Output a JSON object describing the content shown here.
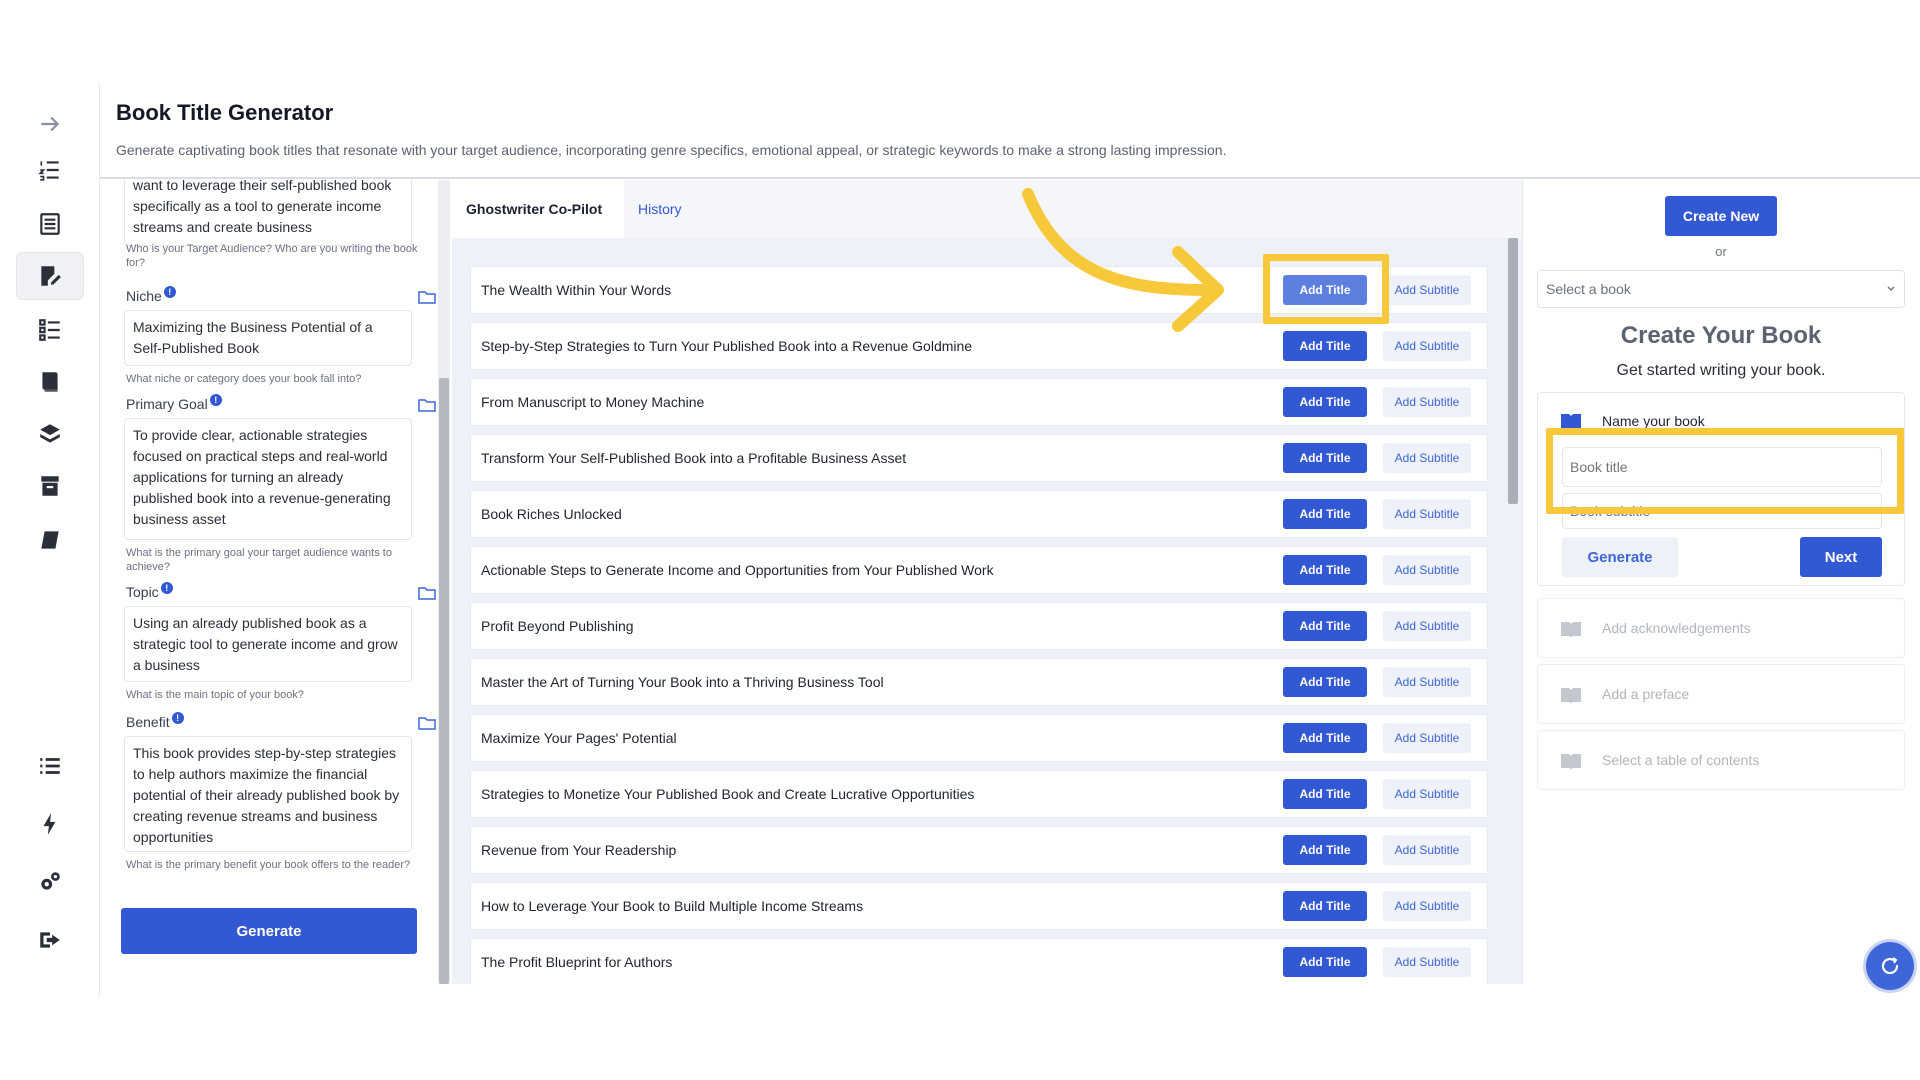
{
  "header": {
    "title": "Book Title Generator",
    "subtitle": "Generate captivating book titles that resonate with your target audience, incorporating genre specifics, emotional appeal, or strategic keywords to make a strong lasting impression."
  },
  "sidebar": {
    "icons": [
      "arrow-right-icon",
      "ordered-list-icon",
      "document-list-icon",
      "edit-document-icon",
      "checklist-icon",
      "book-icon",
      "books-icon",
      "archive-icon",
      "notebook-icon",
      "list-icon",
      "bolt-icon",
      "gears-icon",
      "logout-icon"
    ]
  },
  "form": {
    "audience": {
      "value": "want to leverage their self-published book specifically as a tool to generate income streams and create business",
      "hint": "Who is your Target Audience? Who are you writing the book for?"
    },
    "niche": {
      "label": "Niche",
      "value": "Maximizing the Business Potential of a Self-Published Book",
      "hint": "What niche or category does your book fall into?"
    },
    "goal": {
      "label": "Primary Goal",
      "value": "To provide clear, actionable strategies focused on practical steps and real-world applications for turning an already published book into a revenue-generating business asset",
      "hint": "What is the primary goal your target audience wants to achieve?"
    },
    "topic": {
      "label": "Topic",
      "value": "Using an already published book as a strategic tool to generate income and grow a business",
      "hint": "What is the main topic of your book?"
    },
    "benefit": {
      "label": "Benefit",
      "value": "This book provides step-by-step strategies to help authors maximize the financial potential of their already published book by creating revenue streams and business opportunities",
      "hint": "What is the primary benefit your book offers to the reader?"
    },
    "generate_label": "Generate"
  },
  "tabs": [
    {
      "label": "Ghostwriter Co-Pilot",
      "active": true
    },
    {
      "label": "History",
      "active": false
    }
  ],
  "titles": [
    "The Wealth Within Your Words",
    "Step-by-Step Strategies to Turn Your Published Book into a Revenue Goldmine",
    "From Manuscript to Money Machine",
    "Transform Your Self-Published Book into a Profitable Business Asset",
    "Book Riches Unlocked",
    "Actionable Steps to Generate Income and Opportunities from Your Published Work",
    "Profit Beyond Publishing",
    "Master the Art of Turning Your Book into a Thriving Business Tool",
    "Maximize Your Pages' Potential",
    "Strategies to Monetize Your Published Book and Create Lucrative Opportunities",
    "Revenue from Your Readership",
    "How to Leverage Your Book to Build Multiple Income Streams",
    "The Profit Blueprint for Authors"
  ],
  "row_buttons": {
    "add_title": "Add Title",
    "add_subtitle": "Add Subtitle"
  },
  "right": {
    "create_new": "Create New",
    "or": "or",
    "select_placeholder": "Select a book",
    "heading": "Create Your Book",
    "subheading": "Get started writing your book.",
    "name_label": "Name your book",
    "title_placeholder": "Book title",
    "subtitle_placeholder": "Book subtitle",
    "generate_label": "Generate",
    "next_label": "Next",
    "steps": [
      "Add acknowledgements",
      "Add a preface",
      "Select a table of contents"
    ]
  },
  "colors": {
    "accent": "#3258d4",
    "highlight": "#f7c93a"
  }
}
